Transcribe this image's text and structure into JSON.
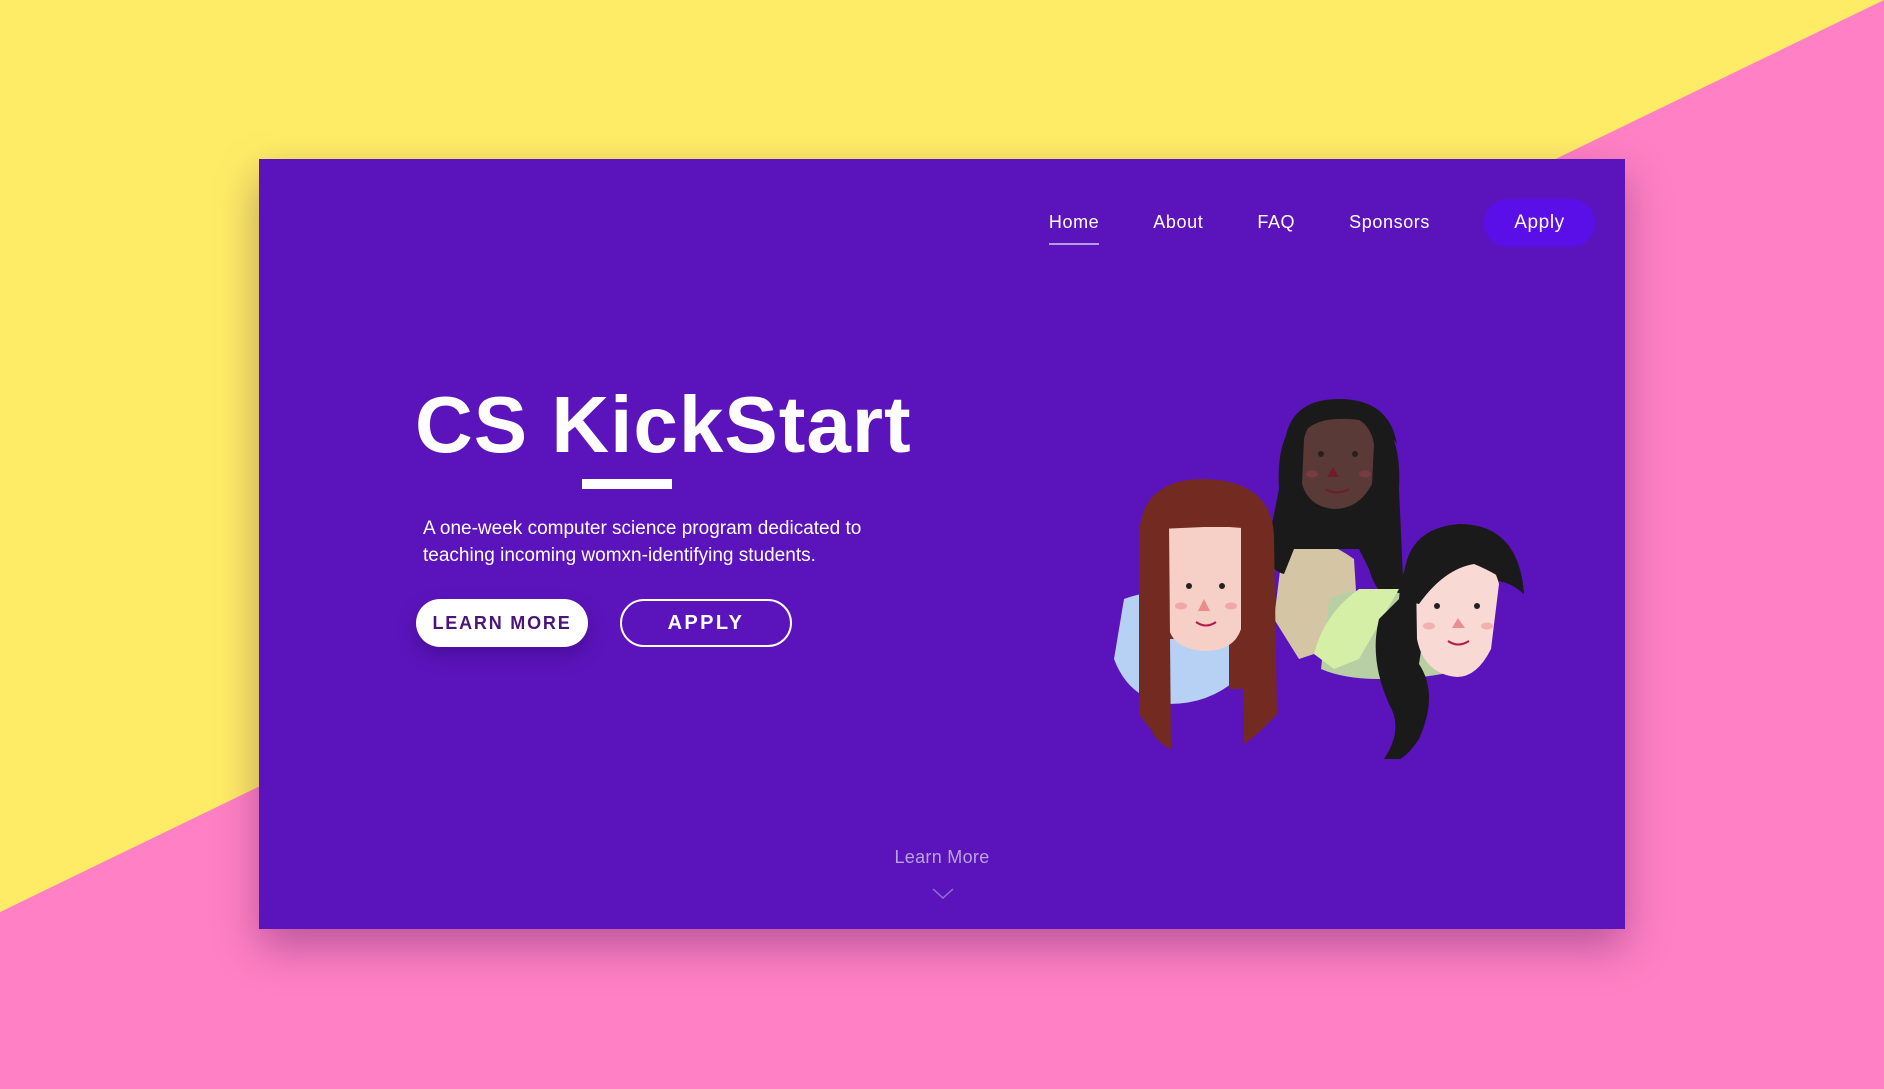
{
  "colors": {
    "background_yellow": "#ffec66",
    "background_pink": "#ff80c4",
    "frame_purple": "#5b14bc",
    "apply_purple": "#5a0fe8",
    "text_white": "#ffffff",
    "learn_more_button_text": "#4a1478",
    "scroll_hint_text": "#b8a3e0"
  },
  "nav": {
    "items": [
      {
        "label": "Home",
        "active": true
      },
      {
        "label": "About",
        "active": false
      },
      {
        "label": "FAQ",
        "active": false
      },
      {
        "label": "Sponsors",
        "active": false
      }
    ],
    "apply_label": "Apply"
  },
  "hero": {
    "title": "CS KickStart",
    "description": "A one-week computer science program dedicated to teaching incoming womxn-identifying students.",
    "learn_more_label": "LEARN MORE",
    "apply_label": "APPLY"
  },
  "scroll_hint": {
    "label": "Learn More",
    "icon": "chevron-down-icon"
  },
  "illustration": {
    "subject": "three-women-illustration"
  }
}
